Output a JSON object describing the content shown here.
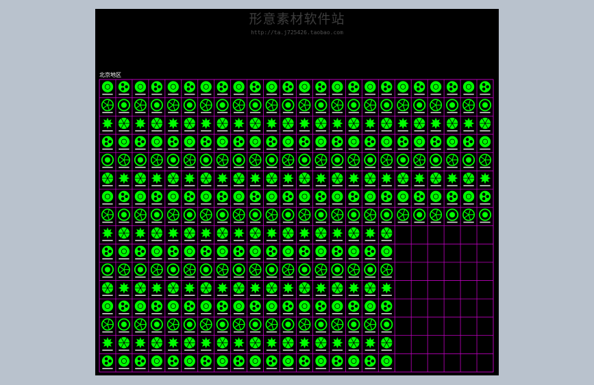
{
  "watermark": {
    "title": "形意素材软件站",
    "url": "http://ta.j725426.taobao.com"
  },
  "drawing": {
    "title": "北京地区",
    "subtitle": "",
    "badge": ""
  },
  "grid": {
    "columns": 24,
    "rows": 16,
    "full_rows": 8,
    "partial_columns": 18
  },
  "colors": {
    "background": "#000000",
    "frame": "#c000c0",
    "symbol": "#00ff00",
    "label": "#ffffff",
    "outer": "#b9c2cd"
  },
  "icons": {
    "plant": "tree-symbol-icon"
  }
}
